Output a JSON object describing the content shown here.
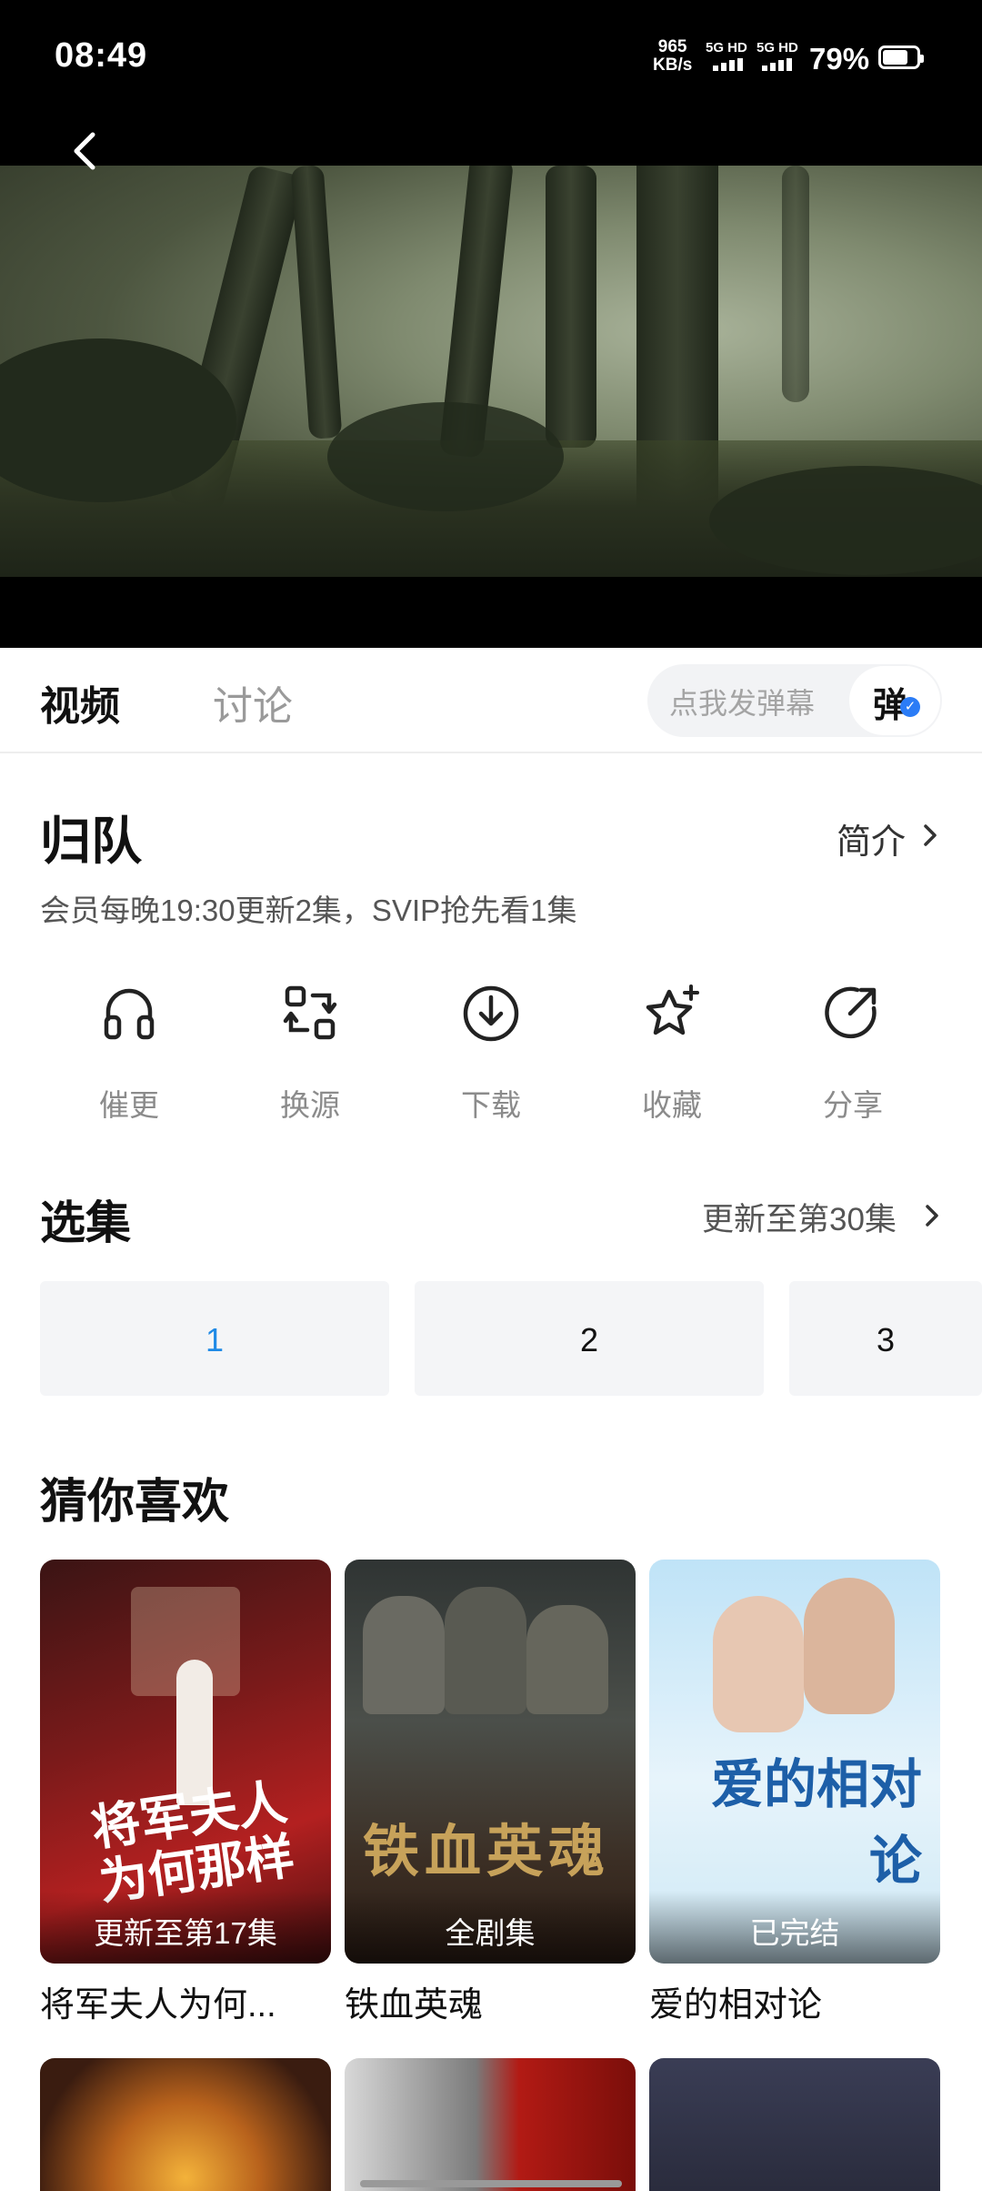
{
  "status_bar": {
    "time": "08:49",
    "net_speed_value": "965",
    "net_speed_unit": "KB/s",
    "signal_1": "5G HD",
    "signal_2": "5G HD",
    "battery_text": "79%",
    "battery_level": 0.79
  },
  "tabs": {
    "video": "视频",
    "discuss": "讨论"
  },
  "danmaku": {
    "placeholder": "点我发弹幕",
    "toggle_label": "弹"
  },
  "show": {
    "title": "归队",
    "intro_label": "简介",
    "schedule": "会员每晚19:30更新2集，SVIP抢先看1集"
  },
  "actions": [
    {
      "label": "催更",
      "icon": "headphones-icon"
    },
    {
      "label": "换源",
      "icon": "switch-source-icon"
    },
    {
      "label": "下载",
      "icon": "download-icon"
    },
    {
      "label": "收藏",
      "icon": "star-add-icon"
    },
    {
      "label": "分享",
      "icon": "share-icon"
    }
  ],
  "episodes": {
    "title": "选集",
    "update_text": "更新至第30集",
    "items": [
      "1",
      "2",
      "3"
    ],
    "active": "1"
  },
  "recommendations": {
    "title": "猜你喜欢",
    "items": [
      {
        "title": "将军夫人为何...",
        "badge": "更新至第17集",
        "art_text": "将军夫人为何那样"
      },
      {
        "title": "铁血英魂",
        "badge": "全剧集",
        "art_text": "铁血英魂"
      },
      {
        "title": "爱的相对论",
        "badge": "已完结",
        "art_text": "爱的相对论"
      }
    ]
  },
  "colors": {
    "accent_blue": "#1f8ae6",
    "toggle_check": "#2b7cf6",
    "tile_bg": "#f4f5f7"
  }
}
